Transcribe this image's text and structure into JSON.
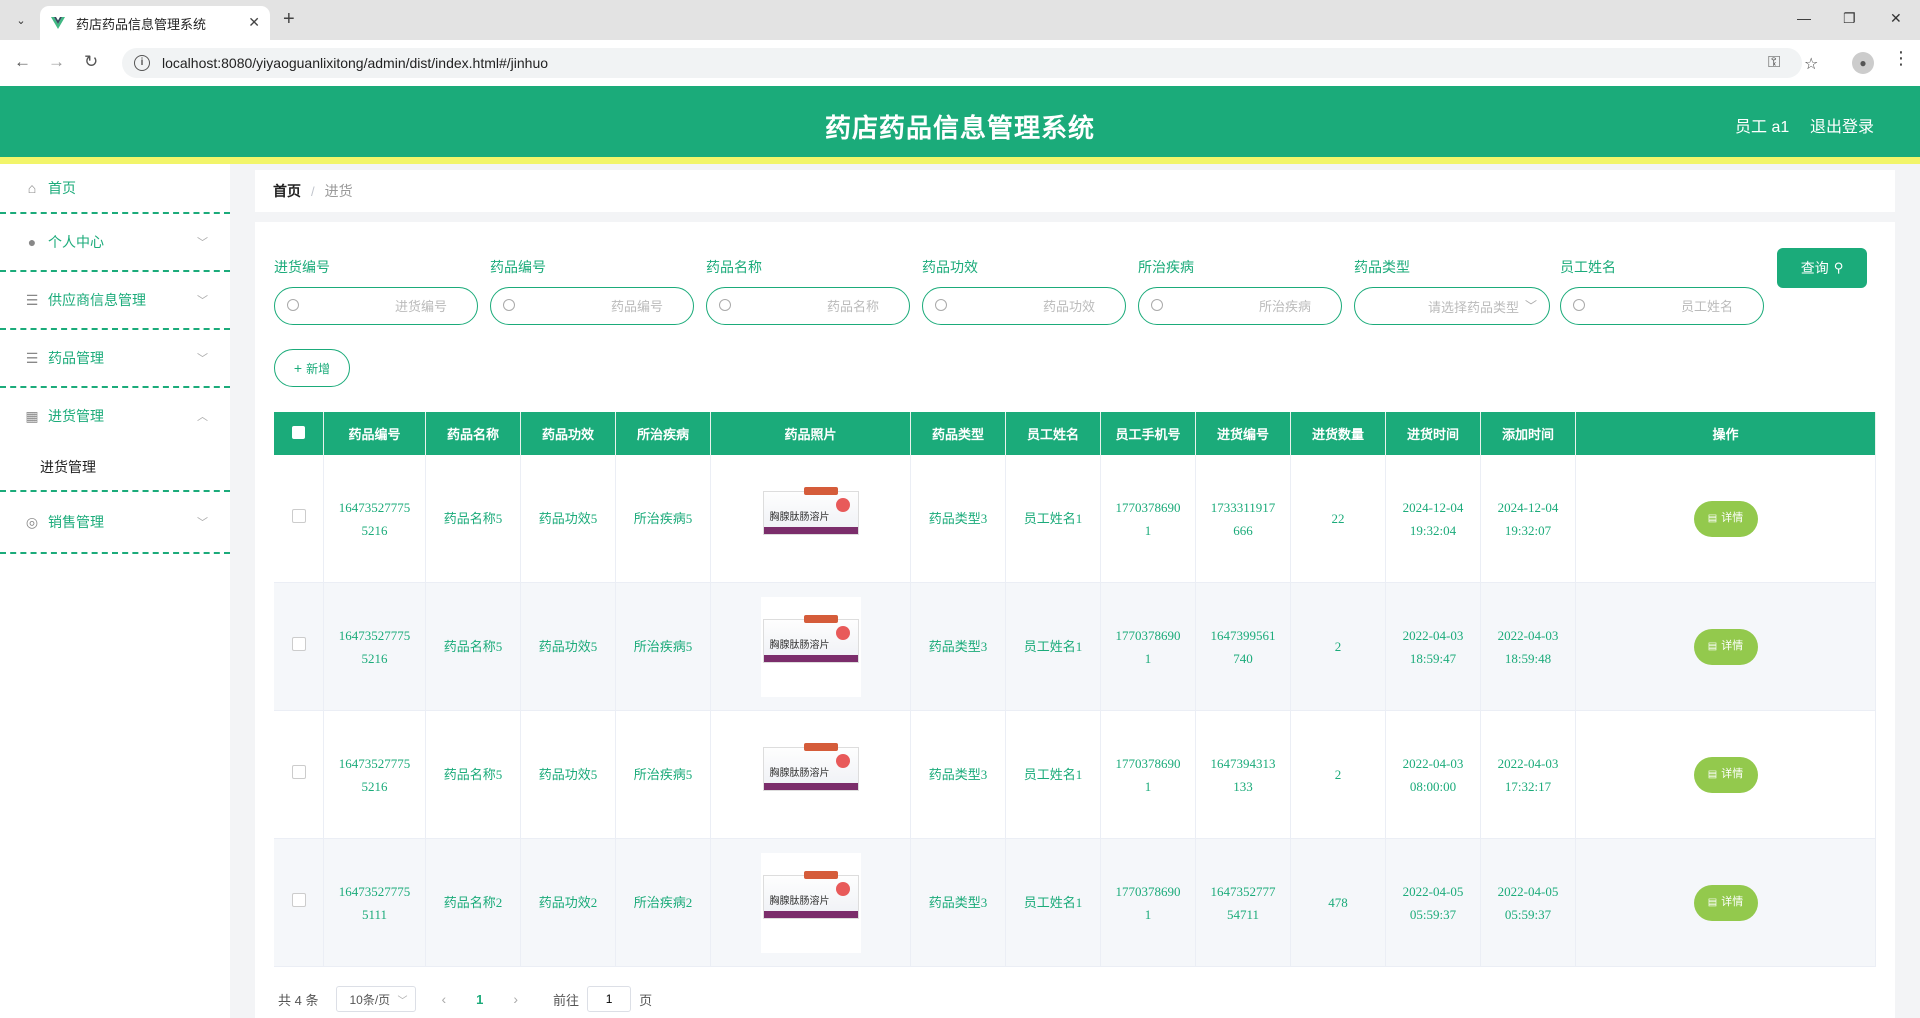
{
  "browser": {
    "tab_title": "药店药品信息管理系统",
    "url": "localhost:8080/yiyaoguanlixitong/admin/dist/index.html#/jinhuo"
  },
  "header": {
    "title": "药店药品信息管理系统",
    "user": "员工 a1",
    "logout": "退出登录"
  },
  "sidebar": {
    "items": [
      {
        "label": "首页",
        "icon": "home-icon"
      },
      {
        "label": "个人中心",
        "icon": "user-icon"
      },
      {
        "label": "供应商信息管理",
        "icon": "list-icon"
      },
      {
        "label": "药品管理",
        "icon": "list-icon"
      },
      {
        "label": "进货管理",
        "icon": "grid-icon"
      },
      {
        "label": "销售管理",
        "icon": "circle-icon"
      }
    ],
    "sub_item": "进货管理"
  },
  "breadcrumb": {
    "home": "首页",
    "sep": "/",
    "current": "进货"
  },
  "filters": [
    {
      "label": "进货编号",
      "placeholder": "进货编号"
    },
    {
      "label": "药品编号",
      "placeholder": "药品编号"
    },
    {
      "label": "药品名称",
      "placeholder": "药品名称"
    },
    {
      "label": "药品功效",
      "placeholder": "药品功效"
    },
    {
      "label": "所治疾病",
      "placeholder": "所治疾病"
    },
    {
      "label": "药品类型",
      "placeholder": "请选择药品类型"
    },
    {
      "label": "员工姓名",
      "placeholder": "员工姓名"
    }
  ],
  "buttons": {
    "query": "查询",
    "add": "新增",
    "detail": "详情"
  },
  "table": {
    "headers": [
      "药品编号",
      "药品名称",
      "药品功效",
      "所治疾病",
      "药品照片",
      "药品类型",
      "员工姓名",
      "员工手机号",
      "进货编号",
      "进货数量",
      "进货时间",
      "添加时间",
      "操作"
    ],
    "rows": [
      {
        "code": [
          "16473527775",
          "5216"
        ],
        "name": "药品名称5",
        "effect": "药品功效5",
        "disease": "所治疾病5",
        "type": "药品类型3",
        "staff": "员工姓名1",
        "phone": [
          "1770378690",
          "1"
        ],
        "no": [
          "1733311917",
          "666"
        ],
        "qty": "22",
        "time": [
          "2024-12-04",
          "19:32:04"
        ],
        "added": [
          "2024-12-04",
          "19:32:07"
        ]
      },
      {
        "code": [
          "16473527775",
          "5216"
        ],
        "name": "药品名称5",
        "effect": "药品功效5",
        "disease": "所治疾病5",
        "type": "药品类型3",
        "staff": "员工姓名1",
        "phone": [
          "1770378690",
          "1"
        ],
        "no": [
          "1647399561",
          "740"
        ],
        "qty": "2",
        "time": [
          "2022-04-03",
          "18:59:47"
        ],
        "added": [
          "2022-04-03",
          "18:59:48"
        ]
      },
      {
        "code": [
          "16473527775",
          "5216"
        ],
        "name": "药品名称5",
        "effect": "药品功效5",
        "disease": "所治疾病5",
        "type": "药品类型3",
        "staff": "员工姓名1",
        "phone": [
          "1770378690",
          "1"
        ],
        "no": [
          "1647394313",
          "133"
        ],
        "qty": "2",
        "time": [
          "2022-04-03",
          "08:00:00"
        ],
        "added": [
          "2022-04-03",
          "17:32:17"
        ]
      },
      {
        "code": [
          "16473527775",
          "5111"
        ],
        "name": "药品名称2",
        "effect": "药品功效2",
        "disease": "所治疾病2",
        "type": "药品类型3",
        "staff": "员工姓名1",
        "phone": [
          "1770378690",
          "1"
        ],
        "no": [
          "1647352777",
          "54711"
        ],
        "qty": "478",
        "time": [
          "2022-04-05",
          "05:59:37"
        ],
        "added": [
          "2022-04-05",
          "05:59:37"
        ]
      }
    ],
    "image_text": "胸腺肽肠溶片"
  },
  "pagination": {
    "total": "共 4 条",
    "page_size": "10条/页",
    "current_page": "1",
    "goto_label": "前往",
    "goto_value": "1",
    "page_suffix": "页"
  },
  "colors": {
    "primary": "#1bab7a",
    "accent": "#f2f56a",
    "detail_button": "#93c94d"
  }
}
